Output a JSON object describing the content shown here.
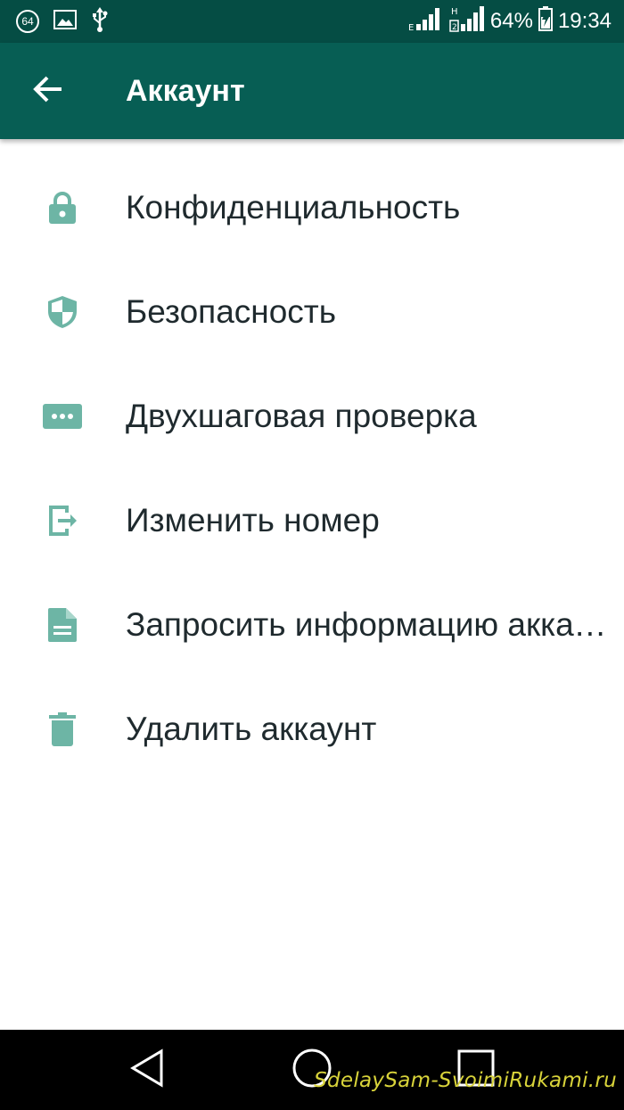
{
  "status_bar": {
    "notification_badge": "64",
    "battery": "64%",
    "time": "19:34",
    "icons": [
      "photo-icon",
      "usb-icon",
      "signal-icon",
      "signal-h-icon",
      "battery-charging-icon"
    ]
  },
  "app_bar": {
    "title": "Аккаунт",
    "back_icon": "arrow-left-icon"
  },
  "menu": {
    "items": [
      {
        "label": "Конфиденциальность",
        "icon": "lock-icon"
      },
      {
        "label": "Безопасность",
        "icon": "shield-icon"
      },
      {
        "label": "Двухшаговая проверка",
        "icon": "dots-box-icon"
      },
      {
        "label": "Изменить номер",
        "icon": "change-number-icon"
      },
      {
        "label": "Запросить информацию аккаунта",
        "icon": "document-icon"
      },
      {
        "label": "Удалить аккаунт",
        "icon": "trash-icon"
      }
    ]
  },
  "nav_bar": {
    "buttons": [
      "back-triangle-icon",
      "home-circle-icon",
      "recents-square-icon"
    ]
  },
  "watermark": "SdelaySam-SvoimiRukami.ru",
  "colors": {
    "status_bar": "#054d44",
    "app_bar": "#075e54",
    "icon_accent": "#6db5a5",
    "text": "#1f2a2e"
  }
}
